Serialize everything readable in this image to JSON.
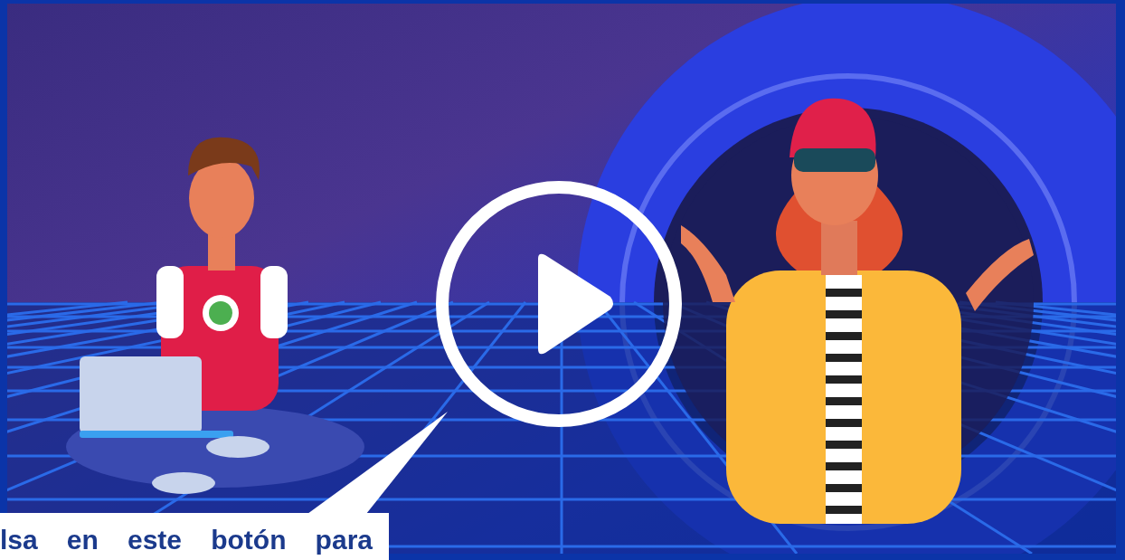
{
  "video": {
    "callout": {
      "text": "lsa en este botón para"
    }
  }
}
